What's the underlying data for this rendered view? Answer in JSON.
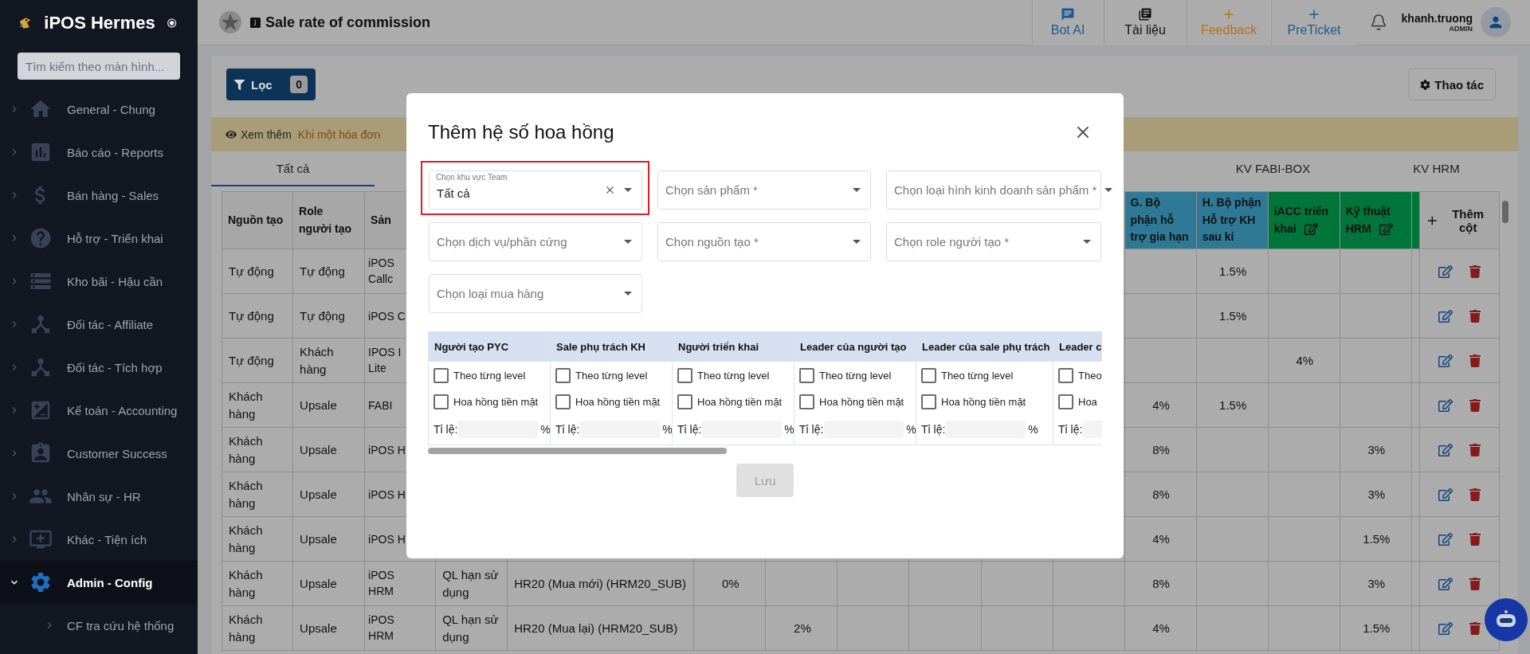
{
  "sidebar": {
    "brand": "iPOS Hermes",
    "search": {
      "placeholder": "Tìm kiếm theo màn hình..."
    },
    "items": [
      {
        "label": "General - Chung",
        "expanded": false
      },
      {
        "label": "Báo cáo - Reports",
        "expanded": false
      },
      {
        "label": "Bán hàng - Sales",
        "expanded": false
      },
      {
        "label": "Hỗ trợ - Triển khai",
        "expanded": false
      },
      {
        "label": "Kho bãi - Hậu cần",
        "expanded": false
      },
      {
        "label": "Đối tác - Affiliate",
        "expanded": false
      },
      {
        "label": "Đối tác - Tích hợp",
        "expanded": false
      },
      {
        "label": "Kế toán - Accounting",
        "expanded": false
      },
      {
        "label": "Customer Success",
        "expanded": false
      },
      {
        "label": "Nhân sự - HR",
        "expanded": false
      },
      {
        "label": "Khác - Tiện ích",
        "expanded": false
      },
      {
        "label": "Admin - Config",
        "expanded": true,
        "children": [
          {
            "label": "CF tra cứu hệ thống",
            "expanded": false
          }
        ]
      }
    ]
  },
  "topbar": {
    "title": "Sale rate of commission",
    "actions": [
      {
        "label": "Bot AI",
        "kind": "chat",
        "color": "#1c5a96"
      },
      {
        "label": "Tài liệu",
        "kind": "docs",
        "color": "#111111"
      },
      {
        "label": "Feedback",
        "kind": "add",
        "color": "#b8701e"
      },
      {
        "label": "PreTicket",
        "kind": "add",
        "color": "#1c5a96"
      }
    ],
    "user": {
      "name": "khanh.truong",
      "role": "ADMIN"
    }
  },
  "toolbar": {
    "filter": {
      "label": "Lọc",
      "count": "0"
    },
    "action": "Thao tác"
  },
  "notice": {
    "link": "Xem thêm",
    "text": "Khi một hóa đơn"
  },
  "tabs": [
    {
      "label": "Tất cả",
      "selected": true
    },
    {
      "label": "KV FABI-BOX",
      "selected": false
    },
    {
      "label": "KV HRM",
      "selected": false
    }
  ],
  "table": {
    "columns": [
      {
        "kind": "plain",
        "label": "Nguồn tạo",
        "editable": false
      },
      {
        "kind": "plain",
        "label": "Role người tạo",
        "editable": false
      },
      {
        "kind": "plain",
        "label": "Sản",
        "editable": false
      },
      {
        "kind": "covered"
      },
      {
        "kind": "covered"
      },
      {
        "kind": "covered"
      },
      {
        "kind": "covered"
      },
      {
        "kind": "covered"
      },
      {
        "kind": "covered"
      },
      {
        "kind": "covered"
      },
      {
        "kind": "covered"
      },
      {
        "kind": "colored",
        "label": "G. Bộ phận hỗ trợ gia hạn",
        "color": "#2e7a96",
        "editable": false
      },
      {
        "kind": "colored",
        "label": "H. Bộ phận Hỗ trợ KH sau kí",
        "color": "#2e7a96",
        "editable": false
      },
      {
        "kind": "colored",
        "label": "iACC triển khai",
        "color": "#00753a",
        "editable": true
      },
      {
        "kind": "colored",
        "label": "Kỹ thuật HRM",
        "color": "#00753a",
        "editable": true
      },
      {
        "kind": "colored",
        "color": "#00753a",
        "editable": false
      }
    ],
    "add_column": "Thêm cột",
    "rows": [
      {
        "cells": [
          "Tự động",
          "Tự động",
          "iPOS Callc",
          null,
          null,
          null,
          null,
          null,
          null,
          null,
          null,
          null,
          "1.5%",
          null,
          null,
          null
        ]
      },
      {
        "cells": [
          "Tự động",
          "Tự động",
          "iPOS C",
          null,
          null,
          null,
          null,
          null,
          null,
          null,
          null,
          null,
          "1.5%",
          null,
          null,
          null
        ]
      },
      {
        "cells": [
          "Tự động",
          "Khách hàng",
          "IPOS I Lite",
          null,
          null,
          null,
          null,
          null,
          null,
          null,
          null,
          null,
          null,
          "4%",
          null,
          null
        ]
      },
      {
        "cells": [
          "Khách hàng",
          "Upsale",
          "FABI",
          null,
          null,
          null,
          null,
          null,
          null,
          null,
          null,
          "4%",
          "1.5%",
          null,
          null,
          null
        ]
      },
      {
        "cells": [
          "Khách hàng",
          "Upsale",
          "iPOS H",
          null,
          null,
          null,
          null,
          null,
          null,
          null,
          null,
          "8%",
          null,
          null,
          "3%",
          null
        ]
      },
      {
        "cells": [
          "Khách hàng",
          "Upsale",
          "iPOS H",
          null,
          null,
          null,
          null,
          null,
          null,
          null,
          null,
          "8%",
          null,
          null,
          "3%",
          null
        ]
      },
      {
        "cells": [
          "Khách hàng",
          "Upsale",
          "iPOS H",
          null,
          null,
          null,
          null,
          null,
          null,
          null,
          null,
          "4%",
          null,
          null,
          "1.5%",
          null
        ]
      },
      {
        "cells": [
          "Khách hàng",
          "Upsale",
          "iPOS HRM",
          "QL hạn sử dụng",
          "HR20 (Mua mới) (HRM20_SUB)",
          "0%",
          null,
          null,
          null,
          null,
          null,
          "8%",
          null,
          null,
          "3%",
          null
        ]
      },
      {
        "cells": [
          "Khách hàng",
          "Upsale",
          "iPOS HRM",
          "QL hạn sử dụng",
          "HR20 (Mua lại) (HRM20_SUB)",
          null,
          "2%",
          null,
          null,
          null,
          null,
          "4%",
          null,
          null,
          "1.5%",
          null
        ]
      }
    ]
  },
  "modal": {
    "title": "Thêm hệ số hoa hồng",
    "fields": [
      {
        "label": "Chọn khu vực Team",
        "value": "Tất cả",
        "highlighted": true
      },
      {
        "placeholder": "Chọn sản phẩm *",
        "highlighted": false
      },
      {
        "placeholder": "Chọn loại hình kinh doanh sản phẩm *",
        "highlighted": false
      },
      {
        "placeholder": "Chọn dịch vụ/phần cứng",
        "highlighted": false
      },
      {
        "placeholder": "Chọn nguồn tạo *",
        "highlighted": false
      },
      {
        "placeholder": "Chọn role người tạo *",
        "highlighted": false
      },
      {
        "placeholder": "Chọn loại mua hàng",
        "highlighted": false
      }
    ],
    "commission_columns": [
      {
        "title": "Người tạo PYC",
        "options": [
          {
            "label": "Theo từng level",
            "checked": false
          },
          {
            "label": "Hoa hồng tiền mặt",
            "checked": false
          }
        ],
        "rate_label": "Tỉ lệ:",
        "unit": "%"
      },
      {
        "title": "Sale phụ trách KH",
        "options": [
          {
            "label": "Theo từng level",
            "checked": false
          },
          {
            "label": "Hoa hồng tiền mặt",
            "checked": false
          }
        ],
        "rate_label": "Tỉ lệ:",
        "unit": "%"
      },
      {
        "title": "Người triển khai",
        "options": [
          {
            "label": "Theo từng level",
            "checked": false
          },
          {
            "label": "Hoa hồng tiền mặt",
            "checked": false
          }
        ],
        "rate_label": "Tỉ lệ:",
        "unit": "%"
      },
      {
        "title": "Leader của người tạo",
        "options": [
          {
            "label": "Theo từng level",
            "checked": false
          },
          {
            "label": "Hoa hồng tiền mặt",
            "checked": false
          }
        ],
        "rate_label": "Tỉ lệ:",
        "unit": "%"
      },
      {
        "title": "Leader của sale phụ trách",
        "options": [
          {
            "label": "Theo từng level",
            "checked": false
          },
          {
            "label": "Hoa hồng tiền mặt",
            "checked": false
          }
        ],
        "rate_label": "Tỉ lệ:",
        "unit": "%"
      },
      {
        "title": "Leader c",
        "options": [
          {
            "label": "Theo",
            "checked": false
          },
          {
            "label": "Hoa",
            "checked": false
          }
        ],
        "rate_label": "Tỉ lệ:"
      }
    ],
    "save": {
      "label": "Lưu",
      "disabled": true
    }
  }
}
